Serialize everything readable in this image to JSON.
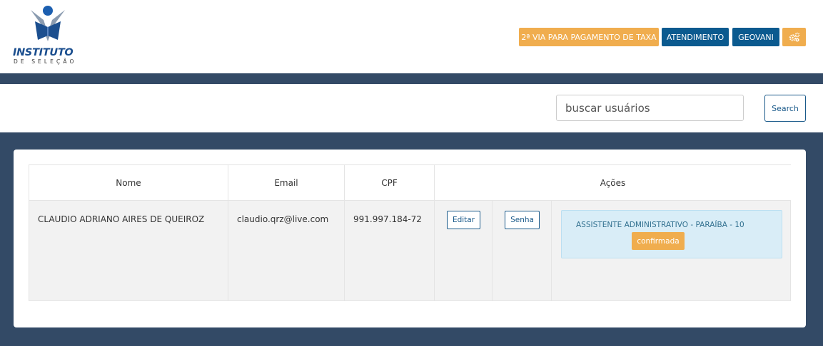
{
  "logo": {
    "title": "INSTITUTO",
    "subtitle": "DE SELEÇÃO"
  },
  "topnav": {
    "taxa_label": "2ª VIA PARA PAGAMENTO DE TAXA",
    "atendimento_label": "ATENDIMENTO",
    "user_label": "GEOVANI",
    "settings_icon": "gears-icon"
  },
  "search": {
    "placeholder": "buscar usuários",
    "button_label": "Search"
  },
  "table": {
    "headers": {
      "nome": "Nome",
      "email": "Email",
      "cpf": "CPF",
      "acoes": "Ações"
    },
    "rows": [
      {
        "nome": "CLAUDIO ADRIANO AIRES DE QUEIROZ",
        "email": "claudio.qrz@live.com",
        "cpf": "991.997.184-72",
        "editar_label": "Editar",
        "senha_label": "Senha",
        "inscricao": "ASSISTENTE ADMINISTRATIVO - PARAÍBA - 10",
        "status": "confirmada"
      }
    ]
  },
  "colors": {
    "navy": "#334a66",
    "orange": "#f0ad4e",
    "blue": "#0b5a8f",
    "info_bg": "#d9edf7"
  }
}
